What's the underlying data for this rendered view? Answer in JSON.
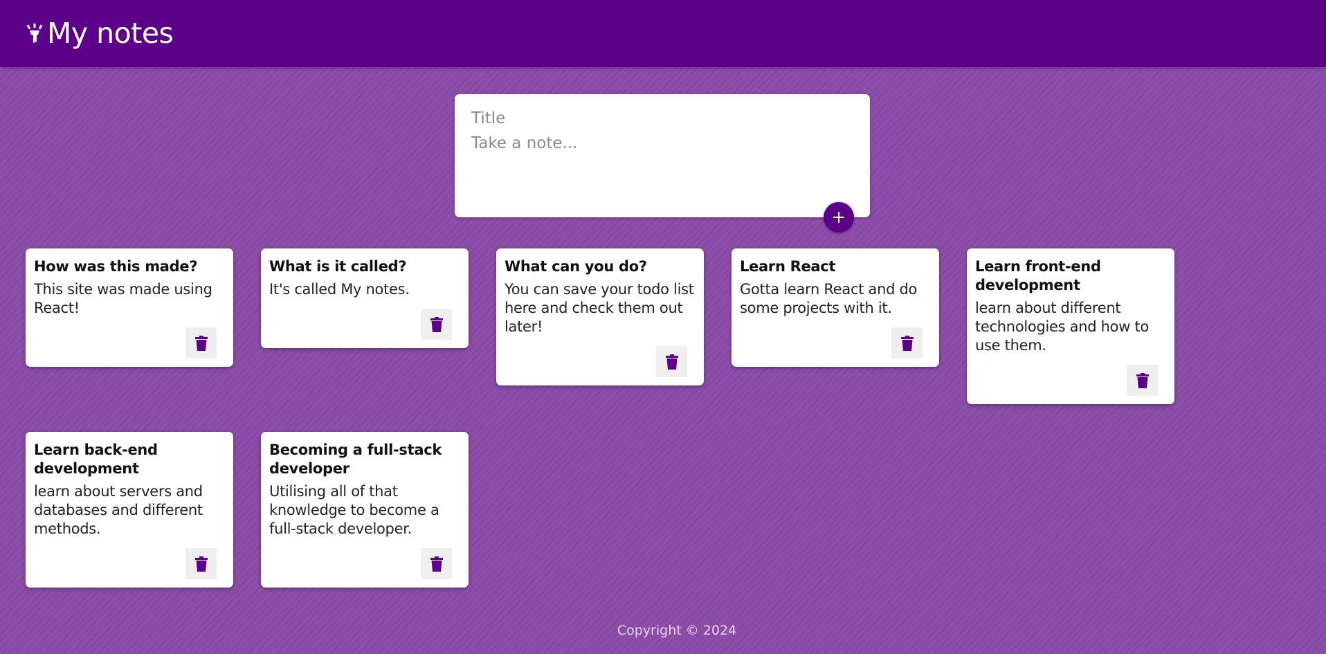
{
  "header": {
    "title": "My notes",
    "logo_icon": "highlight-icon",
    "background_color": "#5c0089"
  },
  "create_area": {
    "title_placeholder": "Title",
    "content_placeholder": "Take a note...",
    "add_button_icon": "plus-icon"
  },
  "notes": [
    {
      "title": "How was this made?",
      "content": "This site was made using React!"
    },
    {
      "title": "What is it called?",
      "content": "It's called My notes."
    },
    {
      "title": "What can you do?",
      "content": "You can save your todo list here and check them out later!"
    },
    {
      "title": "Learn React",
      "content": "Gotta learn React and do some projects with it."
    },
    {
      "title": "Learn front-end development",
      "content": "learn about different technologies and how to use them."
    },
    {
      "title": "Learn back-end development",
      "content": "learn about servers and databases and different methods."
    },
    {
      "title": "Becoming a full-stack developer",
      "content": "Utilising all of that knowledge to become a full-stack developer."
    }
  ],
  "delete_icon": "trash-icon",
  "footer": {
    "text": "Copyright © 2024"
  },
  "colors": {
    "accent": "#5c0089",
    "background": "#8a4aa6"
  }
}
